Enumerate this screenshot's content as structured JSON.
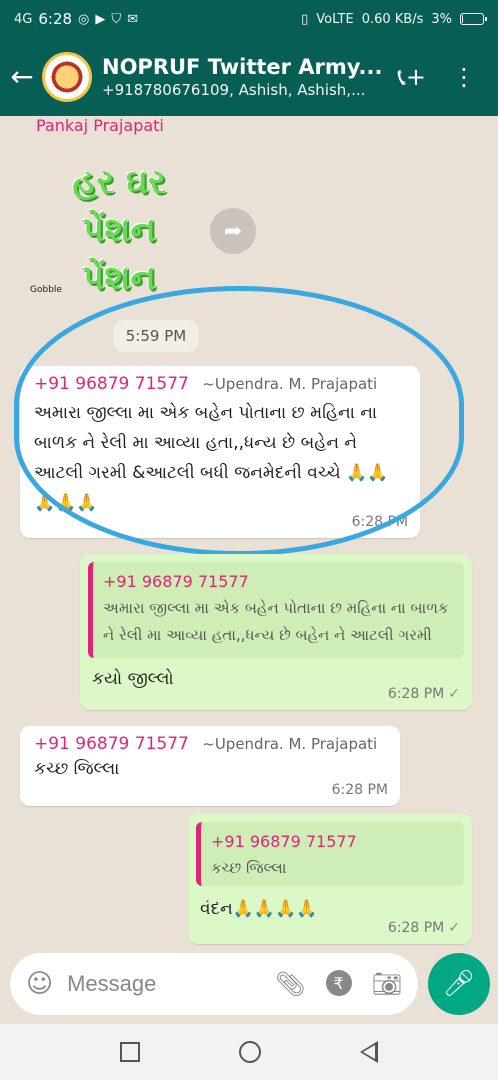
{
  "status_bar": {
    "net": "4G",
    "time": "6:28",
    "icons": [
      "whatsapp-icon",
      "youtube-icon",
      "shield-icon",
      "gmail-icon"
    ],
    "speed": "0.60 KB/s",
    "net_type": "VoLTE",
    "battery": "3%",
    "battery_level": 0.03
  },
  "header": {
    "title": "NOPRUF Twitter Army...",
    "subtitle": "+918780676109, Ashish, Ashish,...",
    "call_icon": "add-call-icon",
    "menu_icon": "more-vert-icon"
  },
  "chat": {
    "top_sender": "Pankaj Prajapati",
    "sticker": {
      "lines": [
        "હર ઘર",
        "પેંશન",
        "પેંશન"
      ],
      "brand": "Gobble"
    },
    "sticker_time": "5:59 PM",
    "messages": [
      {
        "phone": "+91 96879 71577",
        "alias": "~Upendra. M. Prajapati",
        "text": "અમારા જીલ્લા મા  એક બહેન પોતાના છ મહિના ના બાળક ને રેલી મા આવ્યા હતા,,ધન્ય છે બહેન ને  આટલી ગરમી &આટલી બધી જનમેદની વચ્ચે 🙏🙏🙏🙏🙏",
        "time": "6:28 PM"
      },
      {
        "quote_phone": "+91 96879 71577",
        "quote_text": "અમારા જીલ્લા મા  એક બહેન પોતાના છ મહિના ના બાળક ને રેલી મા આવ્યા હતા,,ધન્ય છે બહેન ને આટલી ગરમી &આટલી બધી જનમેદની વચ્ચે 🙏...",
        "text": "કયો જીલ્લો",
        "time": "6:28 PM"
      },
      {
        "phone": "+91 96879 71577",
        "alias": "~Upendra. M. Prajapati",
        "text": "કચ્છ જિલ્લા",
        "time": "6:28 PM"
      },
      {
        "quote_phone": "+91 96879 71577",
        "quote_text": "કચ્છ જિલ્લા",
        "text": "વંદન🙏🙏🙏🙏",
        "time": "6:28 PM"
      }
    ]
  },
  "composer": {
    "placeholder": "Message",
    "icons": [
      "emoji-icon",
      "attach-icon",
      "rupee-icon",
      "camera-icon"
    ],
    "mic_icon": "mic-icon"
  },
  "colors": {
    "header": "#075e54",
    "accent": "#00a884",
    "sender": "#e0247a",
    "outgoing": "#dcf8c6"
  }
}
